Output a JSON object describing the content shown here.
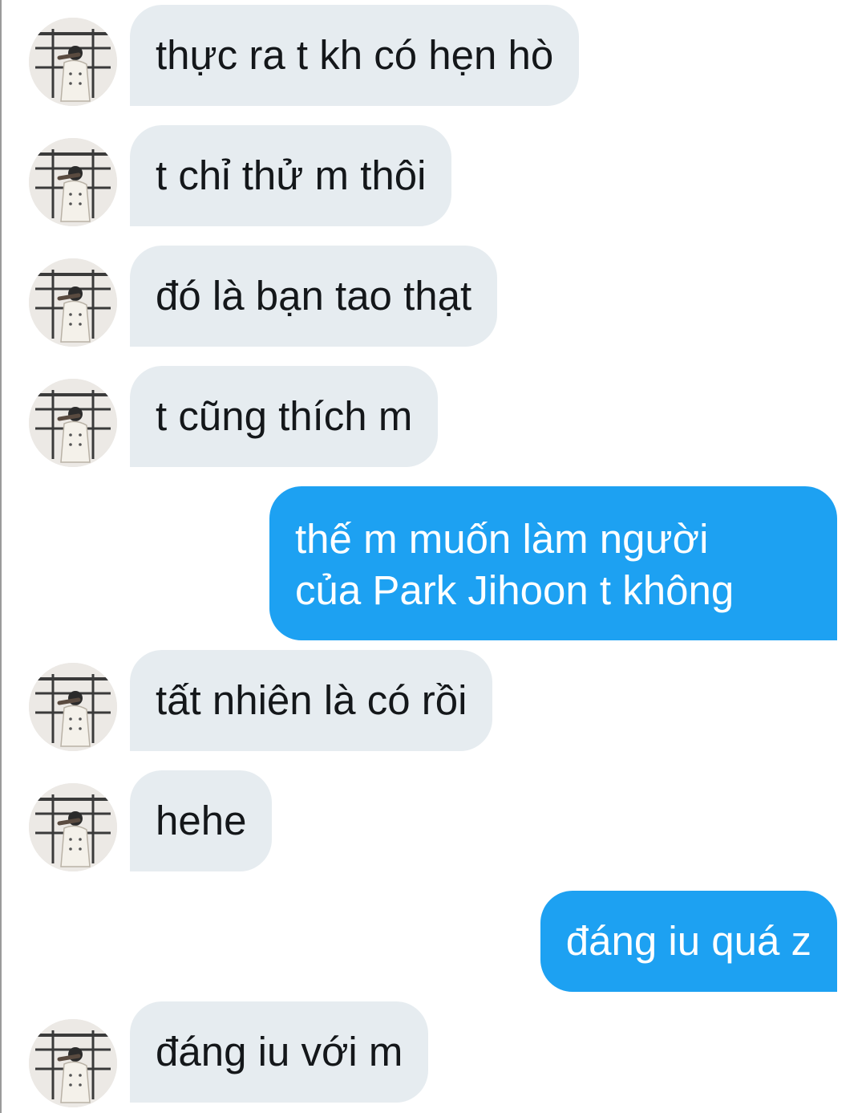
{
  "conversation": {
    "messages": [
      {
        "direction": "in",
        "text": "thực ra t kh có hẹn hò"
      },
      {
        "direction": "in",
        "text": "t chỉ thử m thôi"
      },
      {
        "direction": "in",
        "text": "đó là bạn tao thạt"
      },
      {
        "direction": "in",
        "text": "t cũng thích m"
      },
      {
        "direction": "out",
        "lines": [
          "thế m muốn làm người",
          "của Park Jihoon t không"
        ]
      },
      {
        "direction": "in",
        "text": "tất nhiên là có rồi"
      },
      {
        "direction": "in",
        "text": "hehe"
      },
      {
        "direction": "out",
        "text": "đáng iu quá z"
      },
      {
        "direction": "in",
        "text": "đáng iu với m"
      }
    ]
  },
  "colors": {
    "incoming_bubble": "#e6ecf0",
    "outgoing_bubble": "#1da1f2",
    "incoming_text": "#14171a",
    "outgoing_text": "#ffffff"
  },
  "icons": {
    "avatar": "contact-avatar-photo"
  }
}
